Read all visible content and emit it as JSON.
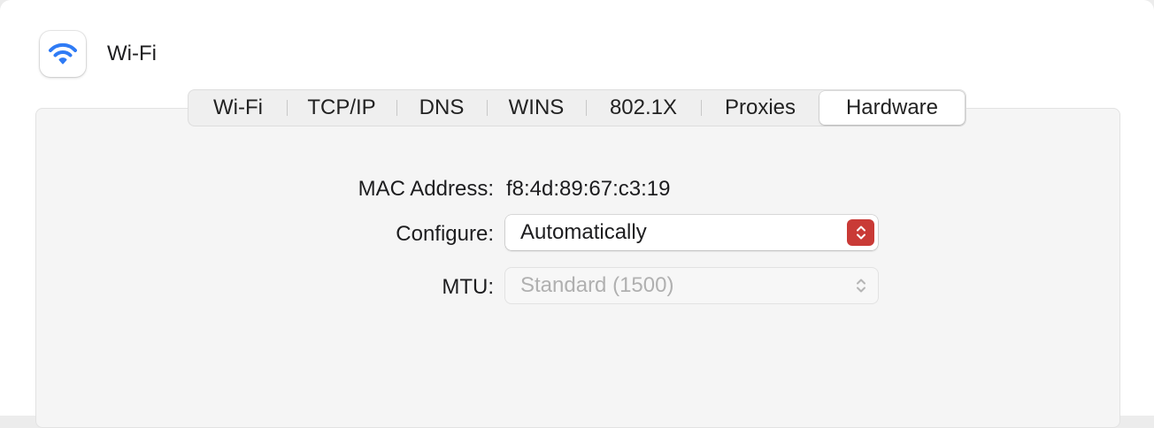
{
  "header": {
    "title": "Wi-Fi",
    "icon": "wifi-icon"
  },
  "tabs": [
    {
      "label": "Wi-Fi",
      "active": false
    },
    {
      "label": "TCP/IP",
      "active": false
    },
    {
      "label": "DNS",
      "active": false
    },
    {
      "label": "WINS",
      "active": false
    },
    {
      "label": "802.1X",
      "active": false
    },
    {
      "label": "Proxies",
      "active": false
    },
    {
      "label": "Hardware",
      "active": true
    }
  ],
  "hardware": {
    "mac_label": "MAC Address:",
    "mac_value": "f8:4d:89:67:c3:19",
    "configure_label": "Configure:",
    "configure_value": "Automatically",
    "mtu_label": "MTU:",
    "mtu_value": "Standard (1500)"
  },
  "colors": {
    "accent": "#2f7bf5",
    "stepper_active": "#c93a36"
  }
}
